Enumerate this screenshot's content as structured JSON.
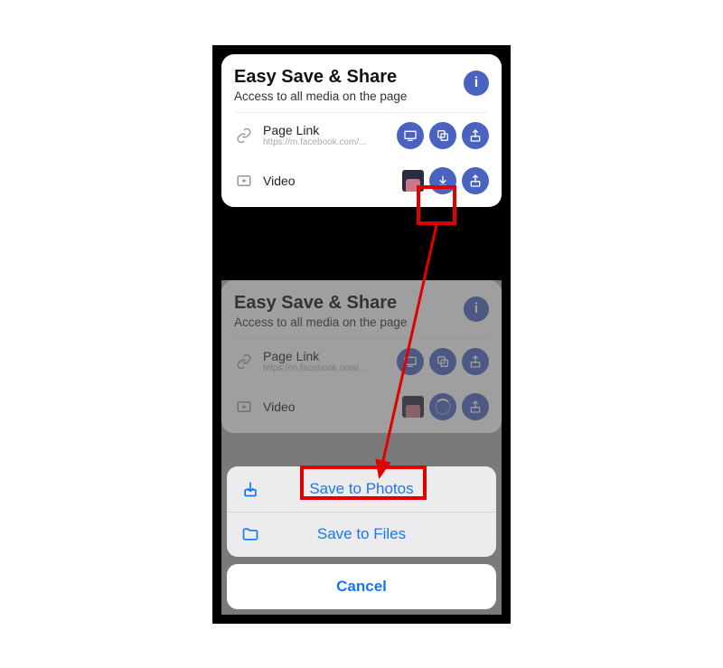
{
  "card": {
    "title": "Easy Save & Share",
    "subtitle": "Access to all media on the page"
  },
  "info_badge": "i",
  "rows": {
    "page_link": {
      "label": "Page Link",
      "url": "https://m.facebook.com/..."
    },
    "video": {
      "label": "Video"
    }
  },
  "sheet": {
    "save_photos": "Save to Photos",
    "save_files": "Save to Files",
    "cancel": "Cancel"
  },
  "colors": {
    "accent": "#4a62c0",
    "link": "#1877f2",
    "highlight": "#e10000"
  }
}
